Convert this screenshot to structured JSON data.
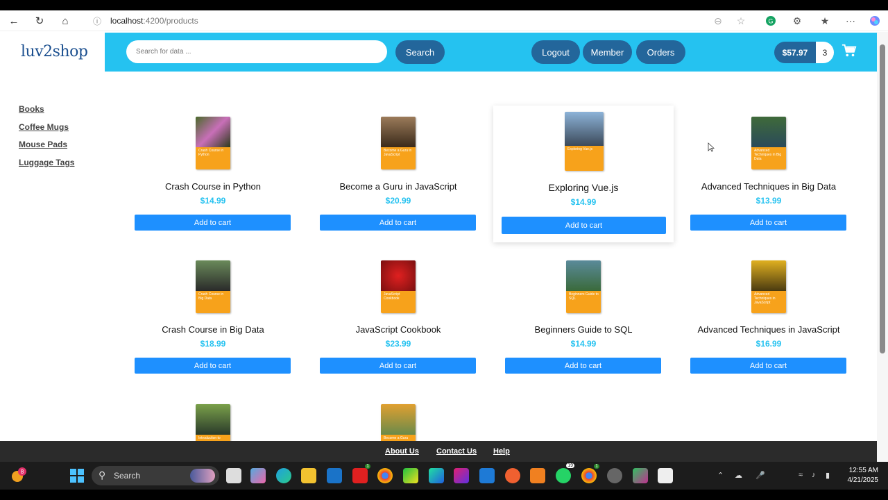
{
  "browser": {
    "url_host": "localhost",
    "url_rest": ":4200/products"
  },
  "header": {
    "logo": "luv2shop",
    "search_placeholder": "Search for data ...",
    "search_button": "Search",
    "logout": "Logout",
    "member": "Member",
    "orders": "Orders",
    "cart_total": "$57.97",
    "cart_count": "3"
  },
  "sidebar": {
    "categories": [
      "Books",
      "Coffee Mugs",
      "Mouse Pads",
      "Luggage Tags"
    ]
  },
  "products": [
    {
      "name": "Crash Course in Python",
      "price": "$14.99",
      "button": "Add to cart",
      "cover_title": "Crash Course in Python"
    },
    {
      "name": "Become a Guru in JavaScript",
      "price": "$20.99",
      "button": "Add to cart",
      "cover_title": "Become a Guru in JavaScript"
    },
    {
      "name": "Exploring Vue.js",
      "price": "$14.99",
      "button": "Add to cart",
      "cover_title": "Exploring Vue.js"
    },
    {
      "name": "Advanced Techniques in Big Data",
      "price": "$13.99",
      "button": "Add to cart",
      "cover_title": "Advanced Techniques in Big Data"
    },
    {
      "name": "Crash Course in Big Data",
      "price": "$18.99",
      "button": "Add to cart",
      "cover_title": "Crash Course in Big Data"
    },
    {
      "name": "JavaScript Cookbook",
      "price": "$23.99",
      "button": "Add to cart",
      "cover_title": "JavaScript Cookbook"
    },
    {
      "name": "Beginners Guide to SQL",
      "price": "$14.99",
      "button": "Add to cart",
      "cover_title": "Beginners Guide to SQL"
    },
    {
      "name": "Advanced Techniques in JavaScript",
      "price": "$16.99",
      "button": "Add to cart",
      "cover_title": "Advanced Techniques in JavaScript"
    },
    {
      "cover_title": "Introduction to"
    },
    {
      "cover_title": "Become a Guru"
    }
  ],
  "footer": {
    "about": "About Us",
    "contact": "Contact Us",
    "help": "Help"
  },
  "taskbar": {
    "search": "Search",
    "time": "12:55 AM",
    "date": "4/21/2025",
    "badges": [
      "8",
      "1",
      "19",
      "1"
    ]
  }
}
